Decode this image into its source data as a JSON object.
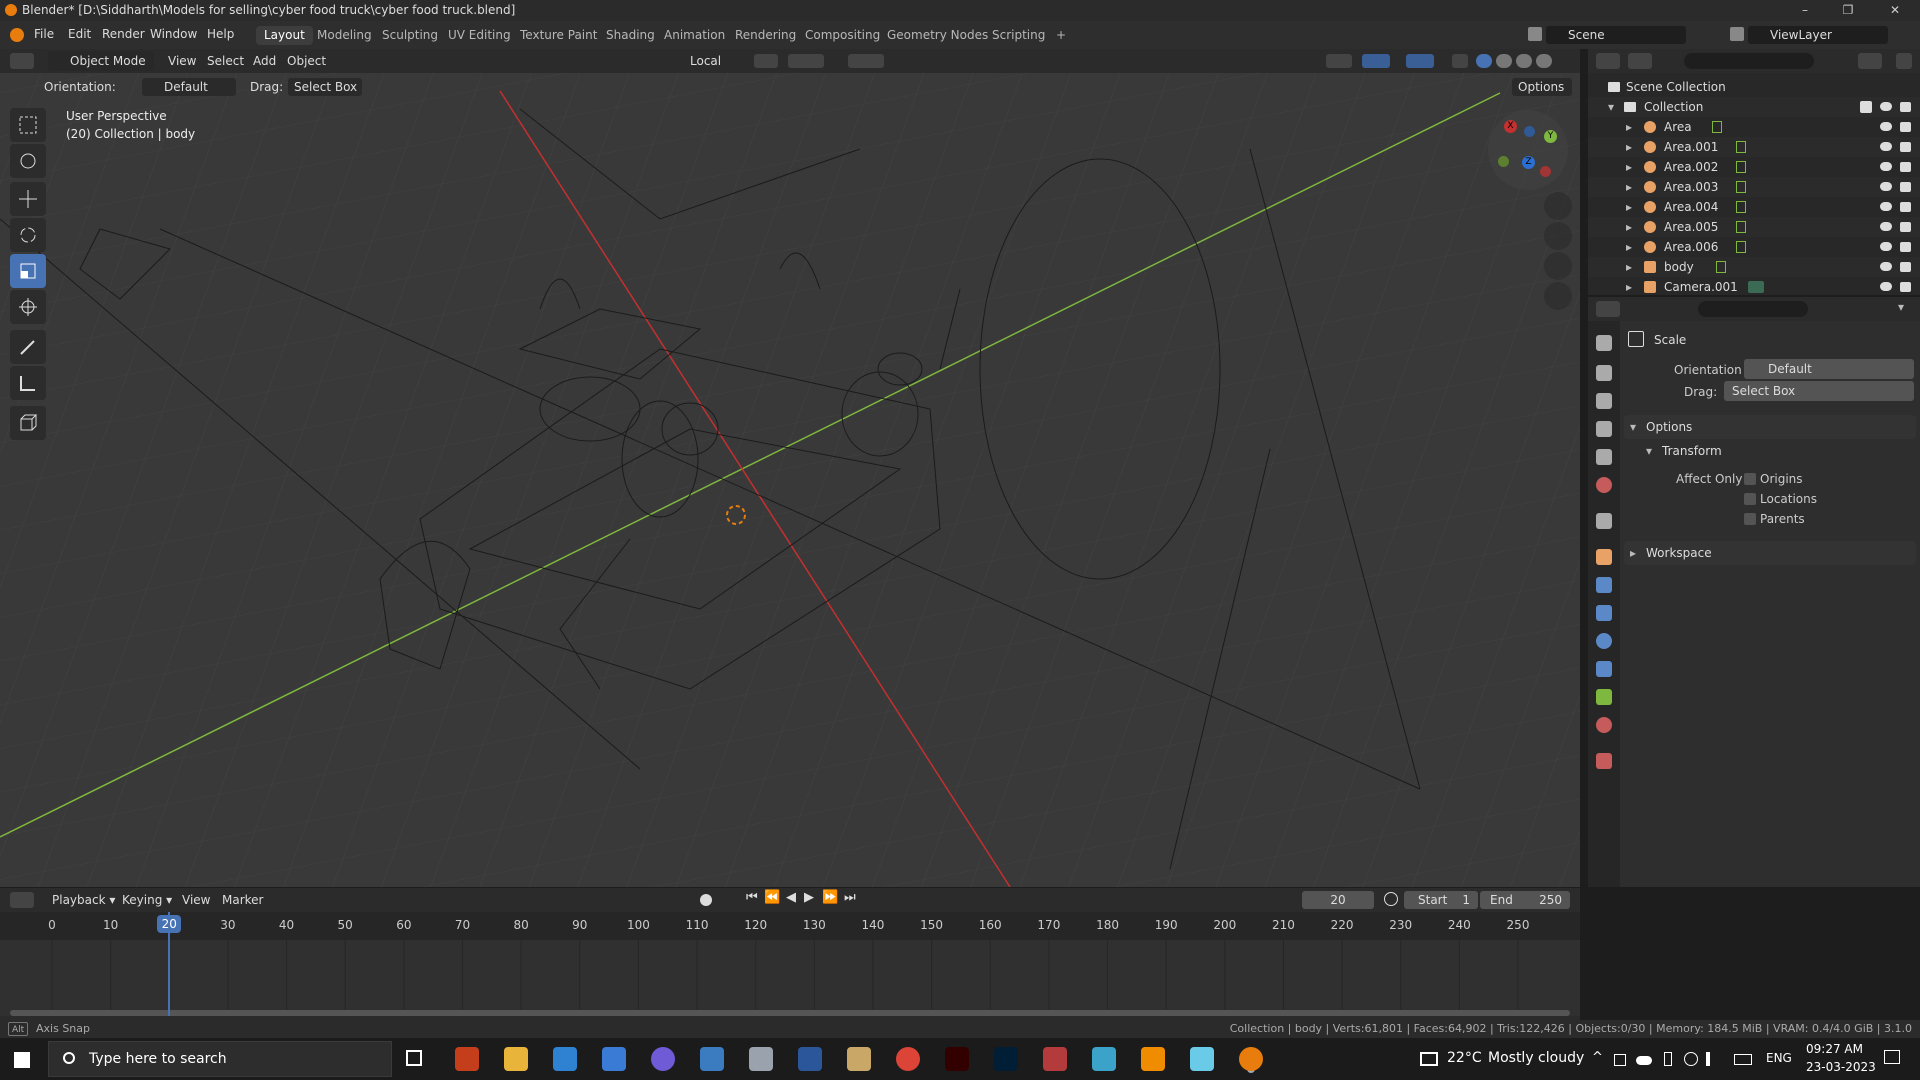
{
  "titlebar": {
    "title": "Blender* [D:\\Siddharth\\Models for selling\\cyber food truck\\cyber food truck.blend]",
    "minimize": "–",
    "maximize": "❐",
    "close": "✕"
  },
  "menu": [
    "File",
    "Edit",
    "Render",
    "Window",
    "Help"
  ],
  "workspaces": [
    "Layout",
    "Modeling",
    "Sculpting",
    "UV Editing",
    "Texture Paint",
    "Shading",
    "Animation",
    "Rendering",
    "Compositing",
    "Geometry Nodes",
    "Scripting"
  ],
  "add_workspace": "+",
  "scene": "Scene",
  "viewlayer": "ViewLayer",
  "viewport_header": {
    "mode": "Object Mode",
    "menus": [
      "View",
      "Select",
      "Add",
      "Object"
    ],
    "transform_orientation": "Local",
    "options": "Options"
  },
  "tool_header": {
    "orientation_label": "Orientation:",
    "orientation_value": "Default",
    "drag_label": "Drag:",
    "drag_value": "Select Box"
  },
  "viewport_overlay": {
    "line1": "User Perspective",
    "line2": "(20) Collection | body"
  },
  "gizmo": {
    "x": "X",
    "y": "Y",
    "z": "Z"
  },
  "outliner": {
    "root": "Scene Collection",
    "collection": "Collection",
    "items": [
      "Area",
      "Area.001",
      "Area.002",
      "Area.003",
      "Area.004",
      "Area.005",
      "Area.006",
      "body",
      "Camera.001"
    ]
  },
  "properties": {
    "tool_name": "Scale",
    "orientation_label": "Orientation",
    "orientation_value": "Default",
    "drag_label": "Drag:",
    "drag_value": "Select Box",
    "options_panel": "Options",
    "transform_panel": "Transform",
    "affect_only_label": "Affect Only",
    "affect_options": [
      "Origins",
      "Locations",
      "Parents"
    ],
    "workspace_panel": "Workspace"
  },
  "timeline": {
    "menus": [
      "Playback",
      "Keying",
      "View",
      "Marker"
    ],
    "current_frame": "20",
    "start_label": "Start",
    "start_value": "1",
    "end_label": "End",
    "end_value": "250",
    "ticks": [
      "0",
      "10",
      "20",
      "30",
      "40",
      "50",
      "60",
      "70",
      "80",
      "90",
      "100",
      "110",
      "120",
      "130",
      "140",
      "150",
      "160",
      "170",
      "180",
      "190",
      "200",
      "210",
      "220",
      "230",
      "240",
      "250"
    ]
  },
  "statusbar": {
    "left_key": "Alt",
    "left_text": "Axis Snap",
    "right_text": "Collection | body | Verts:61,801 | Faces:64,902 | Tris:122,426 | Objects:0/30 | Memory: 184.5 MiB | VRAM: 0.4/4.0 GiB | 3.1.0"
  },
  "taskbar": {
    "search_placeholder": "Type here to search",
    "weather_temp": "22°C",
    "weather_desc": "Mostly cloudy",
    "language": "ENG",
    "time": "09:27 AM",
    "date": "23-03-2023"
  },
  "colors": {
    "accent": "#4772b3",
    "x_axis": "#c43030",
    "y_axis": "#7fb83e",
    "frame_marker": "#4772b3"
  }
}
